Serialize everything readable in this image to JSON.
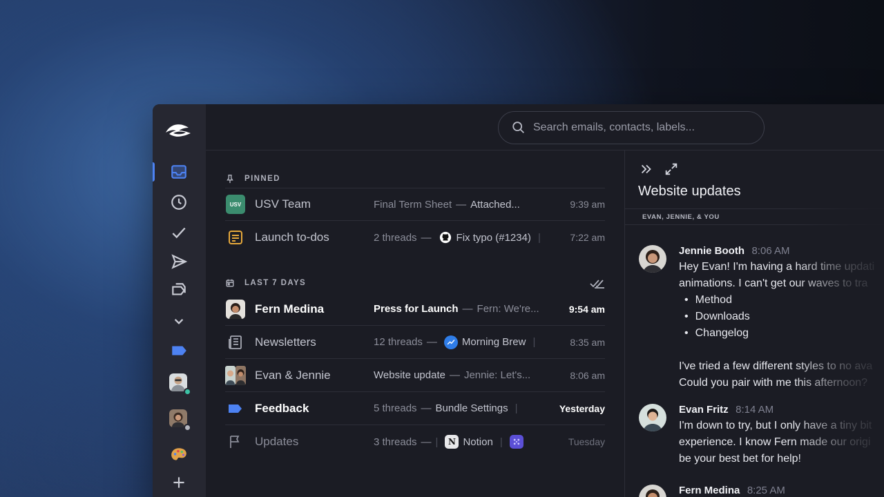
{
  "search": {
    "placeholder": "Search emails, contacts, labels..."
  },
  "sections": {
    "pinned": "PINNED",
    "last7": "LAST 7 DAYS"
  },
  "pinned_rows": [
    {
      "name": "USV Team",
      "badge": "USV",
      "snippet_subject": "Final Term Sheet",
      "snippet_sep": "—",
      "snippet_preview": "Attached...",
      "time": "9:39 am"
    },
    {
      "name": "Launch to-dos",
      "snippet_subject": "2 threads",
      "snippet_sep": "—",
      "snippet_preview": "Fix typo (#1234)",
      "snippet_bar": "|",
      "time": "7:22 am"
    }
  ],
  "recent_rows": [
    {
      "name": "Fern Medina",
      "snippet_subject": "Press for Launch",
      "snippet_sep": "—",
      "snippet_preview": "Fern: We're...",
      "time": "9:54 am",
      "unread": true
    },
    {
      "name": "Newsletters",
      "snippet_subject": "12 threads",
      "snippet_sep": "—",
      "snippet_preview": "Morning Brew",
      "snippet_bar": "|",
      "time": "8:35 am"
    },
    {
      "name": "Evan & Jennie",
      "snippet_subject": "Website update",
      "snippet_sep": "—",
      "snippet_preview": "Jennie: Let's...",
      "time": "8:06 am"
    },
    {
      "name": "Feedback",
      "snippet_subject": "5 threads",
      "snippet_sep": "—",
      "snippet_preview": "Bundle Settings",
      "snippet_bar": "|",
      "time": "Yesterday",
      "unread": true
    },
    {
      "name": "Updates",
      "snippet_subject": "3 threads",
      "snippet_sep": "—",
      "snippet_preview": "Notion",
      "snippet_bar": "|",
      "time": "Tuesday"
    }
  ],
  "reader": {
    "title": "Website updates",
    "participants": "EVAN, JENNIE, & YOU",
    "messages": [
      {
        "sender": "Jennie Booth",
        "time": "8:06 AM",
        "line1": "Hey Evan! I'm having a hard time updati",
        "line2": "animations. I can't get our waves to tra",
        "bullets": [
          "Method",
          "Downloads",
          "Changelog"
        ],
        "line3": "I've tried a few different styles to no ava",
        "line4": "Could you pair with me this afternoon?"
      },
      {
        "sender": "Evan Fritz",
        "time": "8:14 AM",
        "line1": "I'm down to try, but I only have a tiny bit",
        "line2": "experience. I know Fern made our origi",
        "line3": "be your best bet for help!"
      },
      {
        "sender": "Fern Medina",
        "time": "8:25 AM"
      }
    ]
  },
  "colors": {
    "accent": "#4d82f2",
    "usv_green": "#3b8c6e",
    "todo_orange": "#e7a93b"
  }
}
